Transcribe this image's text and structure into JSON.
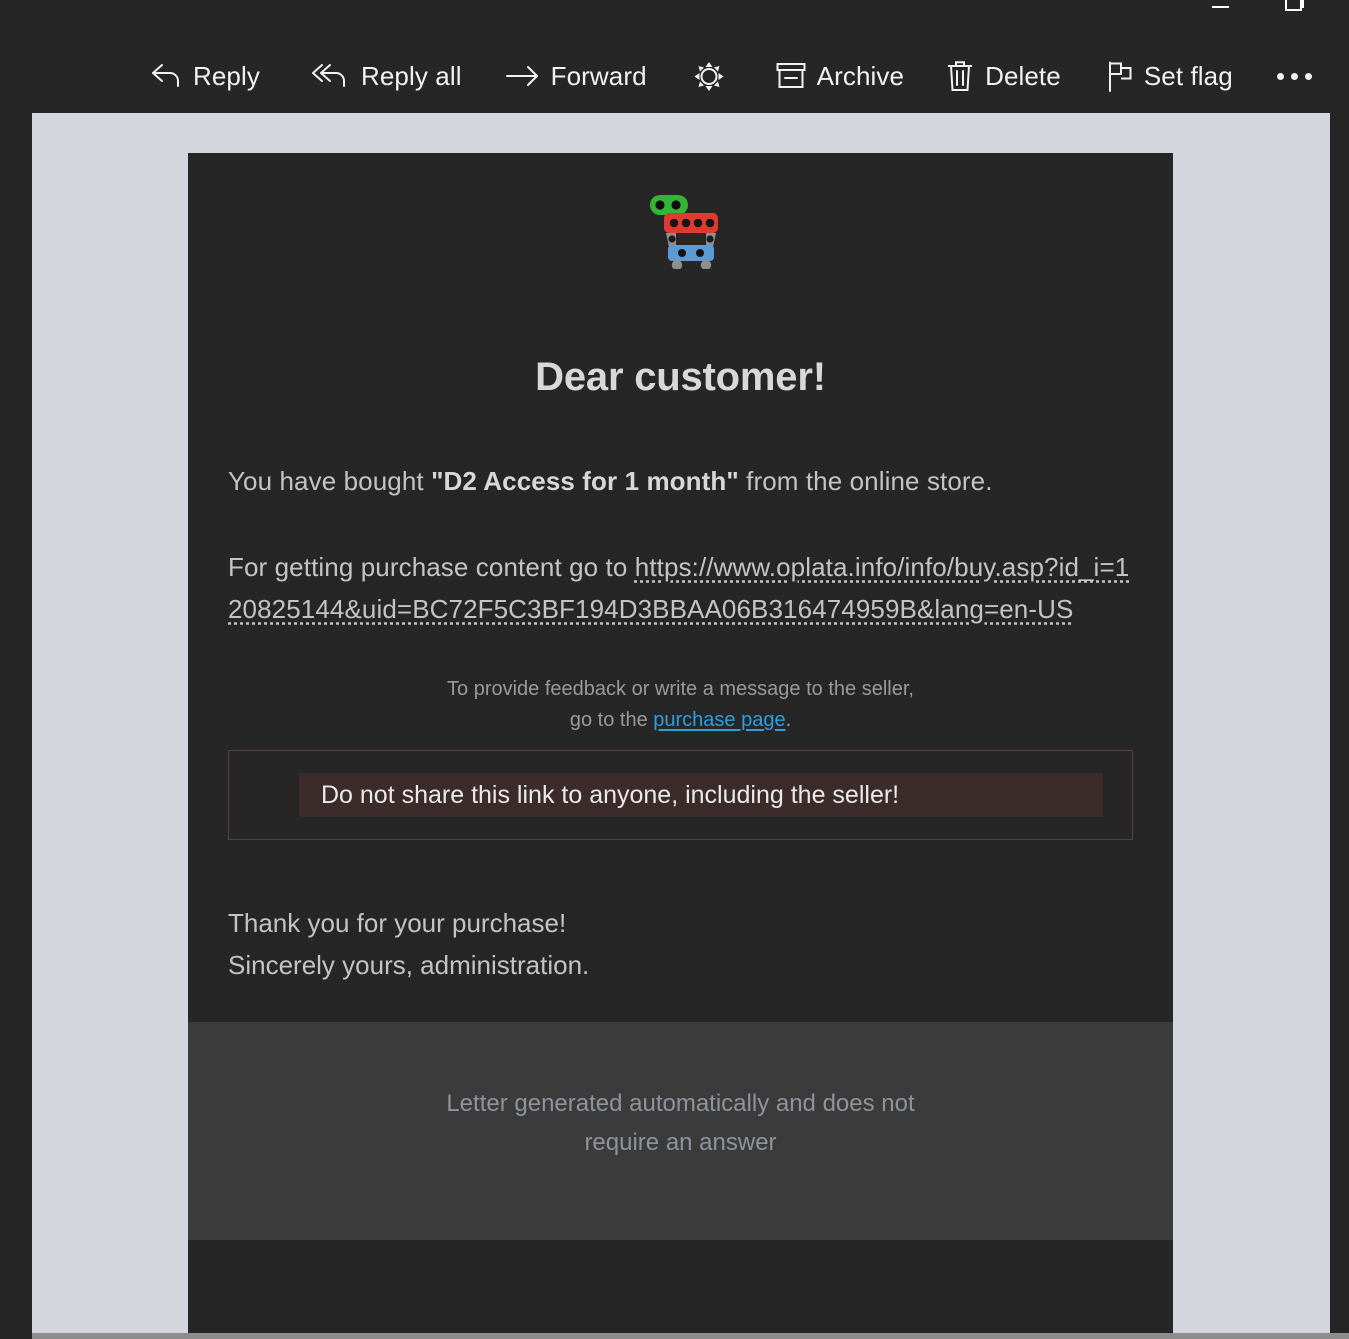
{
  "window": {
    "controls": [
      {
        "name": "minimize",
        "label": "Minimize"
      },
      {
        "name": "restore",
        "label": "Restore Down"
      }
    ]
  },
  "toolbar": {
    "items": [
      {
        "id": "reply",
        "label": "Reply",
        "icon": "reply-icon"
      },
      {
        "id": "reply-all",
        "label": "Reply all",
        "icon": "reply-all-icon"
      },
      {
        "id": "forward",
        "label": "Forward",
        "icon": "forward-arrow-icon"
      },
      {
        "id": "junk",
        "label": "",
        "icon": "junk-sunburst-icon"
      },
      {
        "id": "archive",
        "label": "Archive",
        "icon": "archive-box-icon"
      },
      {
        "id": "delete",
        "label": "Delete",
        "icon": "trash-icon"
      },
      {
        "id": "set-flag",
        "label": "Set flag",
        "icon": "flag-icon"
      },
      {
        "id": "more",
        "label": "",
        "icon": "ellipsis-icon"
      }
    ]
  },
  "email": {
    "logo": "shopping-cart-icon",
    "greeting": "Dear customer!",
    "purchase_line": {
      "prefix": "You have bought ",
      "product": "\"D2 Access for 1 month\"",
      "suffix": " from the online store."
    },
    "link_line": {
      "prefix": "For getting purchase content go to ",
      "url_text": "https://www.oplata.info/info/buy.asp?id_i=120825144&uid=BC72F5C3BF194D3BBAA06B316474959B&lang=en-US"
    },
    "feedback": {
      "line1": "To provide feedback or write a message to the seller,",
      "line2_prefix": "go to the ",
      "link_text": "purchase page",
      "line2_suffix": "."
    },
    "warning": "Do not share this link to anyone, including the seller!",
    "signoff_line1": "Thank you for your purchase!",
    "signoff_line2": "Sincerely yours, administration.",
    "footer_line1": "Letter generated automatically and does not",
    "footer_line2": "require an answer"
  },
  "colors": {
    "app_background": "#262626",
    "reading_pane": "#d4d6dd",
    "email_card": "#262626",
    "email_footer": "#3b3b3b",
    "link_blue": "#2d9ee0",
    "warning_background": "#3b2b2b",
    "warning_border": "#5d3f3f",
    "cart_handle_green": "#35b535",
    "cart_top_red": "#e03a2f",
    "cart_bottom_blue": "#5b9bd5",
    "cart_gray": "#9a9a9a"
  }
}
